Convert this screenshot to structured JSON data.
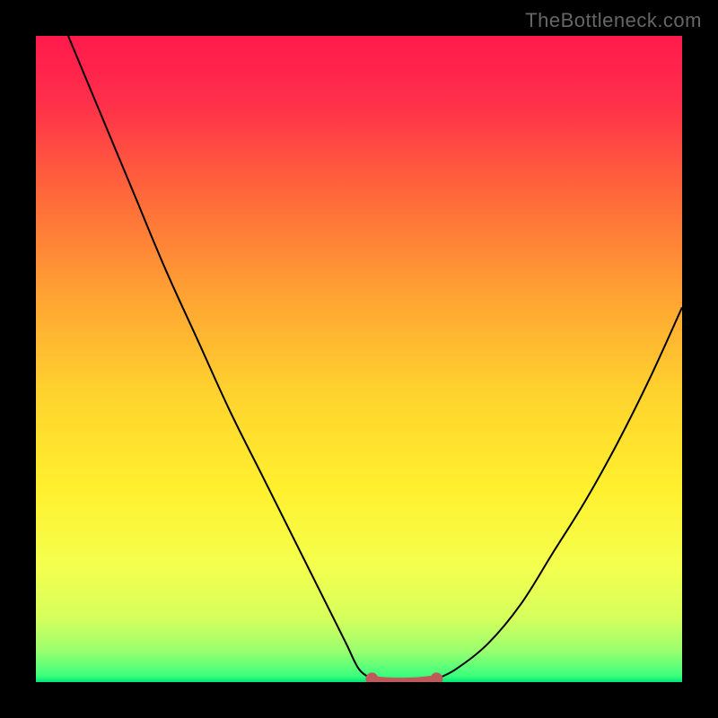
{
  "watermark": "TheBottleneck.com",
  "colors": {
    "frame": "#000000",
    "curve": "#000000",
    "marker": "#c05a5a",
    "gradient_stops": [
      {
        "offset": 0.0,
        "color": "#ff1a4d"
      },
      {
        "offset": 0.1,
        "color": "#ff2e4a"
      },
      {
        "offset": 0.25,
        "color": "#ff6a3a"
      },
      {
        "offset": 0.4,
        "color": "#ffa233"
      },
      {
        "offset": 0.55,
        "color": "#ffd22e"
      },
      {
        "offset": 0.7,
        "color": "#fff02e"
      },
      {
        "offset": 0.82,
        "color": "#f4ff4d"
      },
      {
        "offset": 0.9,
        "color": "#d6ff5c"
      },
      {
        "offset": 0.95,
        "color": "#9dff6e"
      },
      {
        "offset": 0.99,
        "color": "#3dff7d"
      },
      {
        "offset": 1.0,
        "color": "#00e676"
      }
    ]
  },
  "chart_data": {
    "type": "line",
    "title": "",
    "xlabel": "",
    "ylabel": "",
    "xlim": [
      0,
      100
    ],
    "ylim": [
      0,
      100
    ],
    "series": [
      {
        "name": "left-curve",
        "x": [
          5,
          10,
          15,
          20,
          25,
          30,
          35,
          40,
          45,
          48,
          50,
          52
        ],
        "y": [
          100,
          88,
          76,
          64,
          53,
          42,
          32,
          22,
          12,
          6,
          2,
          0.5
        ]
      },
      {
        "name": "right-curve",
        "x": [
          62,
          65,
          70,
          75,
          80,
          85,
          90,
          95,
          100
        ],
        "y": [
          0.5,
          2,
          6,
          12,
          20,
          28,
          37,
          47,
          58
        ]
      },
      {
        "name": "bottom-markers",
        "x": [
          52,
          53,
          54,
          55,
          56,
          57,
          58,
          59,
          60,
          61,
          62
        ],
        "y": [
          0.5,
          0.3,
          0.2,
          0.15,
          0.12,
          0.12,
          0.15,
          0.2,
          0.3,
          0.4,
          0.5
        ]
      }
    ]
  }
}
